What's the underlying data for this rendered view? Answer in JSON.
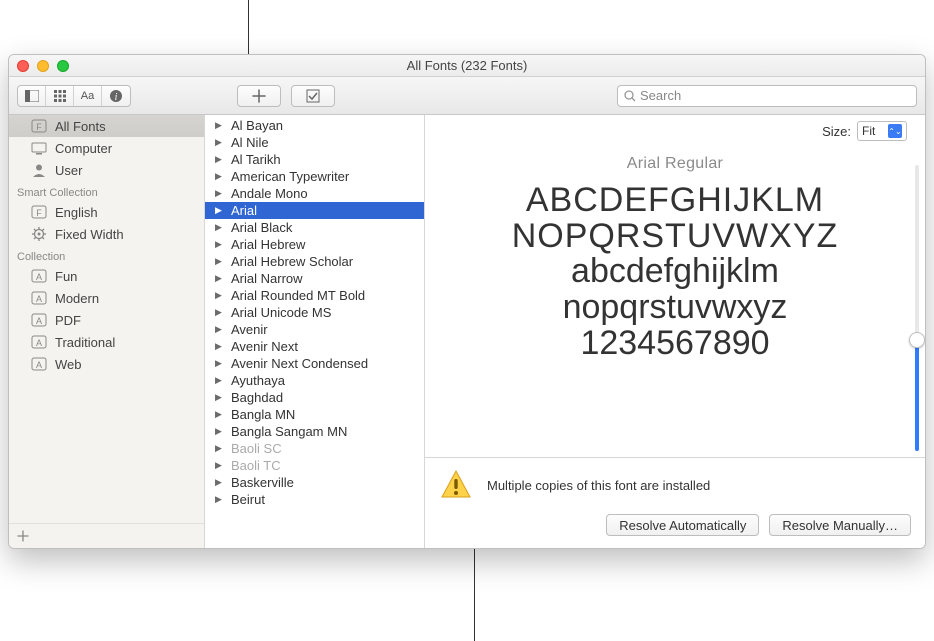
{
  "window": {
    "title": "All Fonts (232 Fonts)"
  },
  "toolbar": {
    "search_placeholder": "Search"
  },
  "sidebar": {
    "library_items": [
      {
        "label": "All Fonts",
        "icon": "F",
        "selected": true
      },
      {
        "label": "Computer",
        "icon": "computer",
        "selected": false
      },
      {
        "label": "User",
        "icon": "user",
        "selected": false
      }
    ],
    "smart_title": "Smart Collection",
    "smart_items": [
      {
        "label": "English",
        "icon": "F"
      },
      {
        "label": "Fixed Width",
        "icon": "gear"
      }
    ],
    "collection_title": "Collection",
    "collection_items": [
      {
        "label": "Fun"
      },
      {
        "label": "Modern"
      },
      {
        "label": "PDF"
      },
      {
        "label": "Traditional"
      },
      {
        "label": "Web"
      }
    ]
  },
  "font_list": [
    {
      "label": "Al Bayan"
    },
    {
      "label": "Al Nile"
    },
    {
      "label": "Al Tarikh"
    },
    {
      "label": "American Typewriter"
    },
    {
      "label": "Andale Mono"
    },
    {
      "label": "Arial",
      "selected": true
    },
    {
      "label": "Arial Black"
    },
    {
      "label": "Arial Hebrew"
    },
    {
      "label": "Arial Hebrew Scholar"
    },
    {
      "label": "Arial Narrow"
    },
    {
      "label": "Arial Rounded MT Bold"
    },
    {
      "label": "Arial Unicode MS"
    },
    {
      "label": "Avenir"
    },
    {
      "label": "Avenir Next"
    },
    {
      "label": "Avenir Next Condensed"
    },
    {
      "label": "Ayuthaya"
    },
    {
      "label": "Baghdad"
    },
    {
      "label": "Bangla MN"
    },
    {
      "label": "Bangla Sangam MN"
    },
    {
      "label": "Baoli SC",
      "dimmed": true
    },
    {
      "label": "Baoli TC",
      "dimmed": true
    },
    {
      "label": "Baskerville"
    },
    {
      "label": "Beirut"
    }
  ],
  "preview": {
    "size_label": "Size:",
    "size_value": "Fit",
    "font_name": "Arial Regular",
    "sample_upper1": "ABCDEFGHIJKLM",
    "sample_upper2": "NOPQRSTUVWXYZ",
    "sample_lower1": "abcdefghijklm",
    "sample_lower2": "nopqrstuvwxyz",
    "sample_digits": "1234567890"
  },
  "warning": {
    "message": "Multiple copies of this font are installed",
    "resolve_auto": "Resolve Automatically",
    "resolve_manual": "Resolve Manually…"
  }
}
